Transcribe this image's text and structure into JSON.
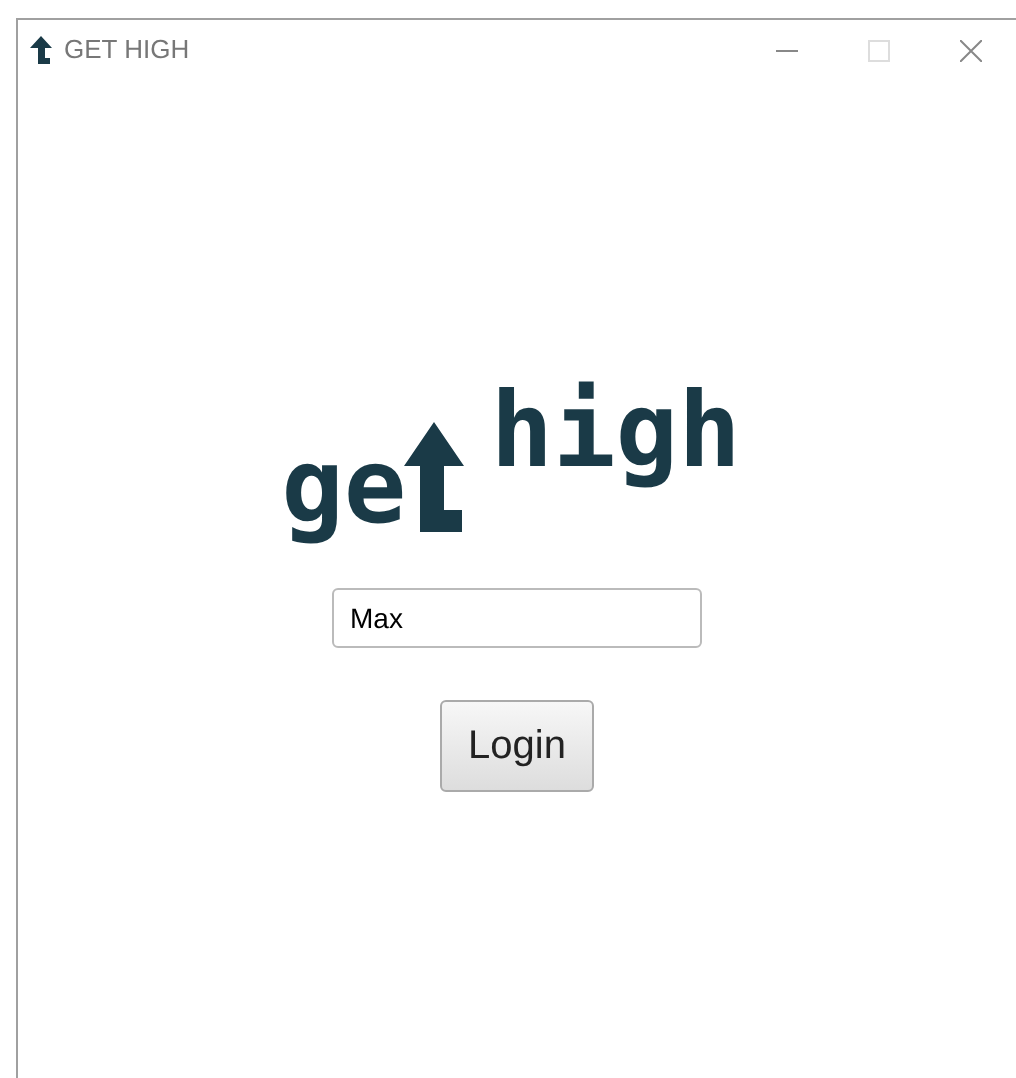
{
  "window": {
    "title": "GET HIGH"
  },
  "logo": {
    "first": "ge",
    "second": "high"
  },
  "name_field": {
    "value": "Max"
  },
  "login_button": {
    "label": "Login"
  }
}
